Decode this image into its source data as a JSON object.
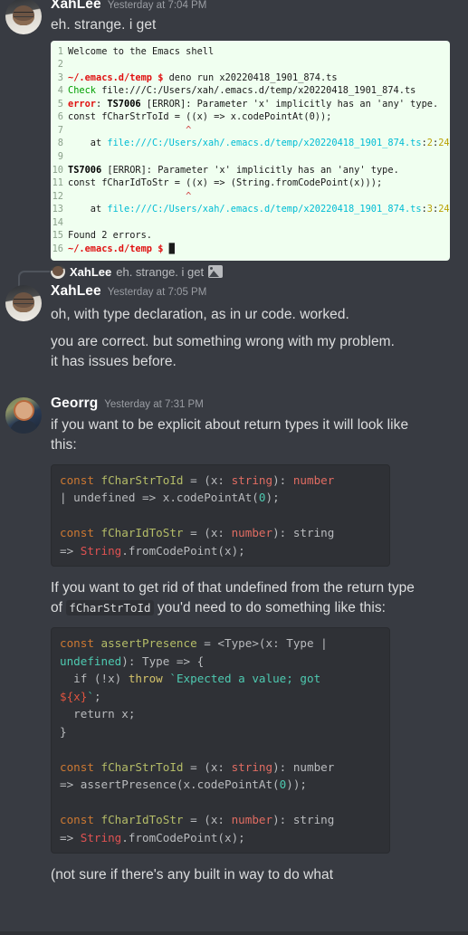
{
  "app": {
    "name": "discord-chat",
    "theme_bg": "#383b42",
    "code_bg": "#2f3136",
    "terminal_bg": "#f0fff0"
  },
  "messages": [
    {
      "author": "XahLee",
      "timestamp": "Yesterday at 7:04 PM",
      "text": "eh. strange. i get"
    },
    {
      "author": "XahLee",
      "timestamp": "Yesterday at 7:05 PM",
      "reply_author": "XahLee",
      "reply_text": "eh. strange. i get",
      "reply_attachment": "image-attachment-icon",
      "line1": "oh, with type declaration, as in ur code. worked.",
      "line2": "you are correct. but something wrong with my problem.",
      "line3": "it has issues before."
    },
    {
      "author": "Georrg",
      "timestamp": "Yesterday at 7:31 PM",
      "para1": "if you want to be explicit about return types it will look like this:",
      "para2_a": "If you want to get rid of that undefined  from the return type of ",
      "para2_code": "fCharStrToId",
      "para2_b": " you'd need to do something like this:",
      "para3": "(not sure if there's any built in way to do what"
    }
  ],
  "terminal": {
    "lines": [
      {
        "n": "1",
        "segs": [
          {
            "t": "Welcome to the Emacs shell",
            "c": "t-def"
          }
        ]
      },
      {
        "n": "2",
        "segs": []
      },
      {
        "n": "3",
        "segs": [
          {
            "t": "~/.emacs.d/temp",
            "c": "t-red"
          },
          {
            "t": " ",
            "c": "t-def"
          },
          {
            "t": "$",
            "c": "t-red"
          },
          {
            "t": " deno run x20220418_1901_874.ts",
            "c": "t-def"
          }
        ]
      },
      {
        "n": "4",
        "segs": [
          {
            "t": "Check",
            "c": "t-green"
          },
          {
            "t": " file:///C:/Users/xah/.emacs.d/temp/x20220418_1901_874.ts",
            "c": "t-def"
          }
        ]
      },
      {
        "n": "5",
        "segs": [
          {
            "t": "error",
            "c": "t-red"
          },
          {
            "t": ": ",
            "c": "t-def"
          },
          {
            "t": "TS7006",
            "c": "t-bold"
          },
          {
            "t": " [ERROR]: Parameter 'x' implicitly has an 'any' type.",
            "c": "t-def"
          }
        ]
      },
      {
        "n": "6",
        "segs": [
          {
            "t": "const fCharStrToId = ((x) => x.codePointAt(0));",
            "c": "t-def"
          }
        ]
      },
      {
        "n": "7",
        "segs": [
          {
            "t": "                     ^",
            "c": "caret"
          }
        ]
      },
      {
        "n": "8",
        "segs": [
          {
            "t": "    at ",
            "c": "t-def"
          },
          {
            "t": "file:///C:/Users/xah/.emacs.d/temp/x20220418_1901_874.ts",
            "c": "t-cyan"
          },
          {
            "t": ":",
            "c": "t-def"
          },
          {
            "t": "2",
            "c": "t-yellow"
          },
          {
            "t": ":",
            "c": "t-def"
          },
          {
            "t": "24",
            "c": "t-yellow"
          }
        ]
      },
      {
        "n": "9",
        "segs": []
      },
      {
        "n": "10",
        "segs": [
          {
            "t": "TS7006",
            "c": "t-bold"
          },
          {
            "t": " [ERROR]: Parameter 'x' implicitly has an 'any' type.",
            "c": "t-def"
          }
        ]
      },
      {
        "n": "11",
        "segs": [
          {
            "t": "const fCharIdToStr = ((x) => (String.fromCodePoint(x)));",
            "c": "t-def"
          }
        ]
      },
      {
        "n": "12",
        "segs": [
          {
            "t": "                     ^",
            "c": "caret"
          }
        ]
      },
      {
        "n": "13",
        "segs": [
          {
            "t": "    at ",
            "c": "t-def"
          },
          {
            "t": "file:///C:/Users/xah/.emacs.d/temp/x20220418_1901_874.ts",
            "c": "t-cyan"
          },
          {
            "t": ":",
            "c": "t-def"
          },
          {
            "t": "3",
            "c": "t-yellow"
          },
          {
            "t": ":",
            "c": "t-def"
          },
          {
            "t": "24",
            "c": "t-yellow"
          }
        ]
      },
      {
        "n": "14",
        "segs": []
      },
      {
        "n": "15",
        "segs": [
          {
            "t": "Found 2 errors.",
            "c": "t-def"
          }
        ]
      },
      {
        "n": "16",
        "segs": [
          {
            "t": "~/.emacs.d/temp",
            "c": "t-red"
          },
          {
            "t": " ",
            "c": "t-def"
          },
          {
            "t": "$",
            "c": "t-red"
          },
          {
            "t": " ",
            "c": "t-def"
          },
          {
            "t": "█",
            "c": "t-def"
          }
        ]
      }
    ]
  },
  "code_block_1": [
    [
      {
        "t": "const",
        "c": "c-kw"
      },
      {
        "t": " ",
        "c": "c-plain"
      },
      {
        "t": "fCharStrToId",
        "c": "c-const"
      },
      {
        "t": " = (x: ",
        "c": "c-plain"
      },
      {
        "t": "string",
        "c": "c-type"
      },
      {
        "t": "): ",
        "c": "c-plain"
      },
      {
        "t": "number",
        "c": "c-type"
      }
    ],
    [
      {
        "t": "| undefined => x.codePointAt(",
        "c": "c-plain"
      },
      {
        "t": "0",
        "c": "c-num"
      },
      {
        "t": ");",
        "c": "c-plain"
      }
    ],
    [],
    [
      {
        "t": "const",
        "c": "c-kw"
      },
      {
        "t": " ",
        "c": "c-plain"
      },
      {
        "t": "fCharIdToStr",
        "c": "c-const"
      },
      {
        "t": " = (x: ",
        "c": "c-plain"
      },
      {
        "t": "number",
        "c": "c-type"
      },
      {
        "t": "): string",
        "c": "c-plain"
      }
    ],
    [
      {
        "t": "=> ",
        "c": "c-plain"
      },
      {
        "t": "String",
        "c": "c-class"
      },
      {
        "t": ".fromCodePoint(x);",
        "c": "c-plain"
      }
    ]
  ],
  "code_block_2": [
    [
      {
        "t": "const",
        "c": "c-kw"
      },
      {
        "t": " ",
        "c": "c-plain"
      },
      {
        "t": "assertPresence",
        "c": "c-const"
      },
      {
        "t": " = <Type>(x: Type |",
        "c": "c-plain"
      }
    ],
    [
      {
        "t": "undefined",
        "c": "c-teal"
      },
      {
        "t": "): Type => {",
        "c": "c-plain"
      }
    ],
    [
      {
        "t": "  if (!x) ",
        "c": "c-plain"
      },
      {
        "t": "throw",
        "c": "c-yellow"
      },
      {
        "t": " ",
        "c": "c-plain"
      },
      {
        "t": "`Expected a value; got",
        "c": "c-str"
      }
    ],
    [
      {
        "t": "${x}",
        "c": "c-red"
      },
      {
        "t": "`",
        "c": "c-str"
      },
      {
        "t": ";",
        "c": "c-plain"
      }
    ],
    [
      {
        "t": "  return x;",
        "c": "c-plain"
      }
    ],
    [
      {
        "t": "}",
        "c": "c-plain"
      }
    ],
    [],
    [
      {
        "t": "const",
        "c": "c-kw"
      },
      {
        "t": " ",
        "c": "c-plain"
      },
      {
        "t": "fCharStrToId",
        "c": "c-const"
      },
      {
        "t": " = (x: ",
        "c": "c-plain"
      },
      {
        "t": "string",
        "c": "c-type"
      },
      {
        "t": "): number",
        "c": "c-plain"
      }
    ],
    [
      {
        "t": "=> assertPresence(x.codePointAt(",
        "c": "c-plain"
      },
      {
        "t": "0",
        "c": "c-num"
      },
      {
        "t": "));",
        "c": "c-plain"
      }
    ],
    [],
    [
      {
        "t": "const",
        "c": "c-kw"
      },
      {
        "t": " ",
        "c": "c-plain"
      },
      {
        "t": "fCharIdToStr",
        "c": "c-const"
      },
      {
        "t": " = (x: ",
        "c": "c-plain"
      },
      {
        "t": "number",
        "c": "c-type"
      },
      {
        "t": "): string",
        "c": "c-plain"
      }
    ],
    [
      {
        "t": "=> ",
        "c": "c-plain"
      },
      {
        "t": "String",
        "c": "c-class"
      },
      {
        "t": ".fromCodePoint(x);",
        "c": "c-plain"
      }
    ]
  ]
}
